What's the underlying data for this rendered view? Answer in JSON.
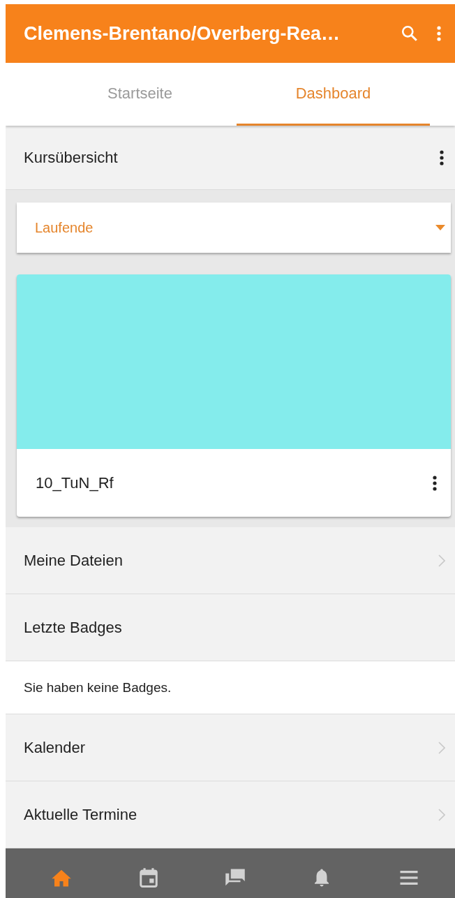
{
  "app_bar": {
    "title": "Clemens-Brentano/Overberg-Rea…"
  },
  "tabs": [
    {
      "label": "Startseite",
      "selected": false
    },
    {
      "label": "Dashboard",
      "selected": true
    }
  ],
  "course_overview": {
    "title": "Kursübersicht",
    "filter": {
      "value": "Laufende"
    },
    "courses": [
      {
        "name": "10_TuN_Rf",
        "color": "#84ecec"
      }
    ]
  },
  "sections": [
    {
      "kind": "link",
      "label": "Meine Dateien"
    },
    {
      "kind": "header",
      "label": "Letzte Badges"
    },
    {
      "kind": "message",
      "label": "Sie haben keine Badges."
    },
    {
      "kind": "link",
      "label": "Kalender"
    },
    {
      "kind": "link",
      "label": "Aktuelle Termine"
    }
  ],
  "bottom_nav": [
    {
      "kind": "home",
      "selected": true
    },
    {
      "kind": "calendar",
      "selected": false
    },
    {
      "kind": "messages",
      "selected": false
    },
    {
      "kind": "notifications",
      "selected": false
    },
    {
      "kind": "menu",
      "selected": false
    }
  ]
}
